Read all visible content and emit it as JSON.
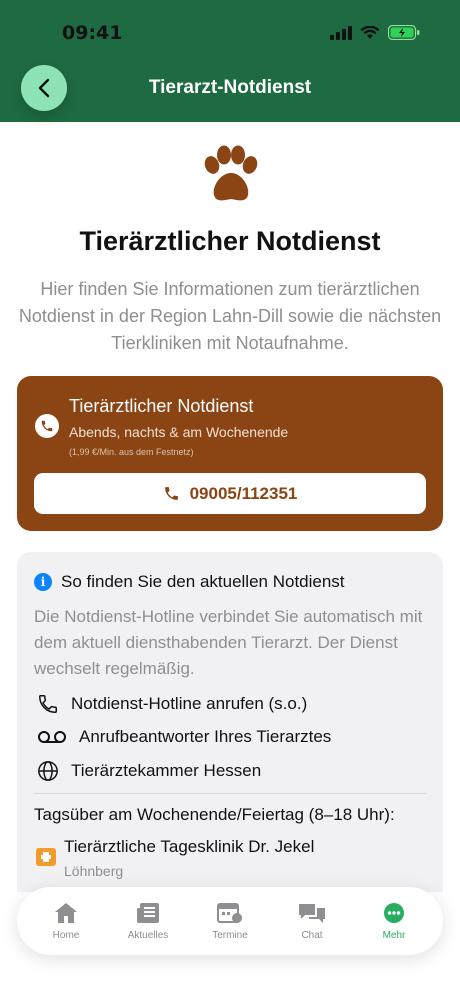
{
  "status_bar": {
    "time": "09:41"
  },
  "nav": {
    "title": "Tierarzt-Notdienst"
  },
  "page": {
    "title": "Tierärztlicher Notdienst",
    "intro": "Hier finden Sie Informationen zum tierärztlichen Notdienst in der Region Lahn-Dill sowie die nächsten Tierkliniken mit Notaufnahme."
  },
  "hotline_card": {
    "title": "Tierärztlicher Notdienst",
    "subtitle": "Abends, nachts & am Wochenende",
    "fine_print": "(1,99 €/Min. aus dem Festnetz)",
    "phone": "09005/112351",
    "color": "#8b4413"
  },
  "info_card": {
    "heading": "So finden Sie den aktuellen Notdienst",
    "body": "Die Notdienst-Hotline verbindet Sie automatisch mit dem aktuell diensthabenden Tierarzt. Der Dienst wechselt regelmäßig.",
    "links": [
      {
        "label": "Notdienst-Hotline anrufen (s.o.)",
        "icon": "phone-icon"
      },
      {
        "label": "Anrufbeantworter Ihres Tierarztes",
        "icon": "voicemail-icon"
      },
      {
        "label": "Tierärztekammer Hessen",
        "icon": "globe-icon"
      }
    ],
    "daytime_heading": "Tagsüber am Wochenende/Feiertag (8–18 Uhr):",
    "clinic": {
      "name": "Tierärztliche Tagesklinik Dr. Jekel",
      "location": "Löhnberg"
    }
  },
  "tabbar": {
    "tabs": [
      {
        "label": "Home",
        "icon": "home-icon"
      },
      {
        "label": "Aktuelles",
        "icon": "news-icon"
      },
      {
        "label": "Termine",
        "icon": "calendar-icon"
      },
      {
        "label": "Chat",
        "icon": "chat-icon"
      },
      {
        "label": "Mehr",
        "icon": "more-icon"
      }
    ],
    "active": "Mehr"
  },
  "colors": {
    "header": "#1e6b43",
    "accent_green": "#27ae60",
    "brown": "#8b4413"
  }
}
